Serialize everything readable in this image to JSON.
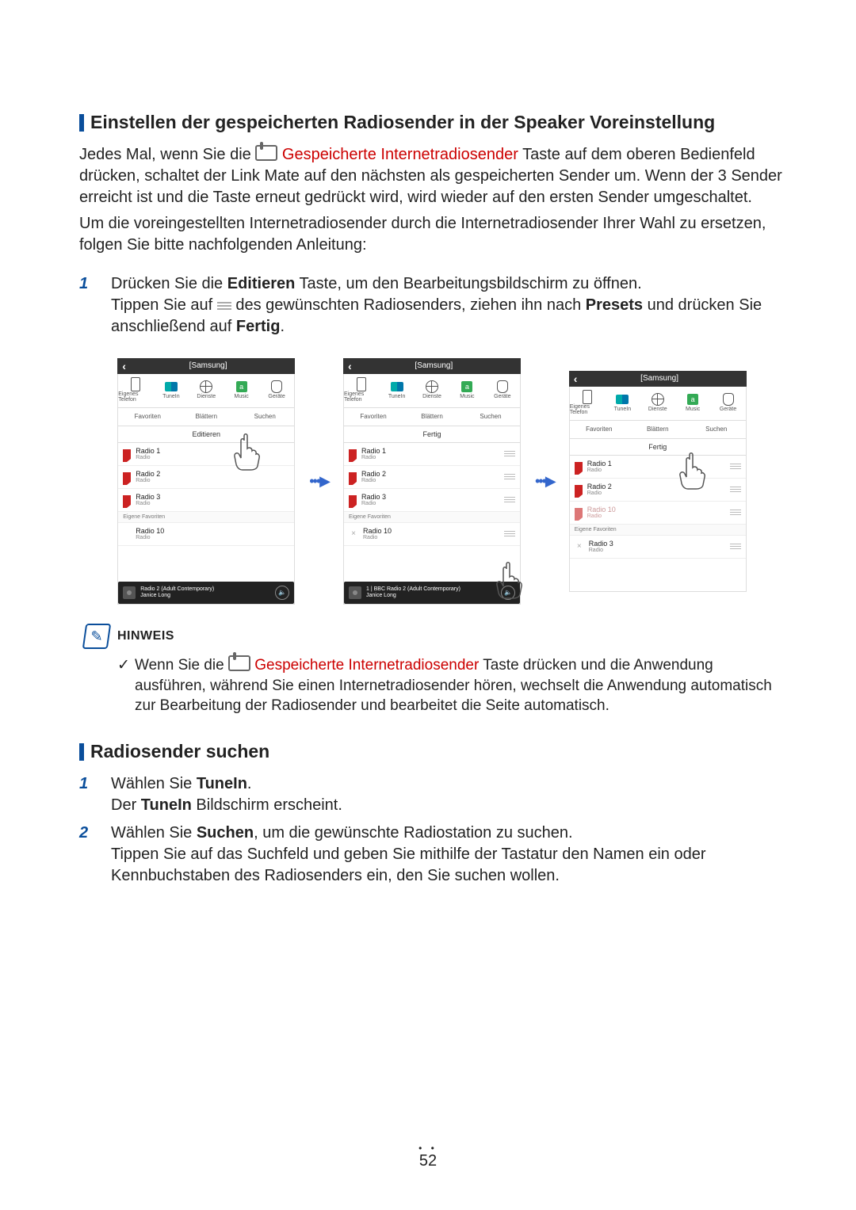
{
  "section1": {
    "heading": "Einstellen der gespeicherten Radiosender in der Speaker Voreinstellung",
    "p1a": "Jedes Mal, wenn Sie die ",
    "p1b_red": "Gespeicherte Internetradiosender",
    "p1c": " Taste auf dem oberen Bedienfeld drücken, schaltet der Link Mate auf den nächsten als gespeicherten Sender um. Wenn der 3 Sender erreicht ist und die Taste erneut gedrückt wird, wird wieder auf den ersten Sender umgeschaltet.",
    "p2": "Um die voreingestellten Internetradiosender durch die Internetradiosender Ihrer Wahl zu ersetzen, folgen Sie bitte nachfolgenden Anleitung:",
    "step1_num": "1",
    "step1a": "Drücken Sie die ",
    "step1_bold1": "Editieren",
    "step1b": " Taste, um den Bearbeitungsbildschirm zu öffnen.",
    "step1c": "Tippen Sie auf ",
    "step1d": " des gewünschten Radiosenders, ziehen ihn nach ",
    "step1_bold2": "Presets",
    "step1e": " und drücken Sie anschließend auf ",
    "step1_bold3": "Fertig",
    "step1f": "."
  },
  "phone": {
    "title": "[Samsung]",
    "nav": {
      "own": "Eigenes Telefon",
      "tunein": "TuneIn",
      "dienste": "Dienste",
      "music": "Music",
      "gerate": "Geräte"
    },
    "tabs": {
      "fav": "Favoriten",
      "browse": "Blättern",
      "search": "Suchen"
    },
    "edit": "Editieren",
    "done": "Fertig",
    "eigene": "Eigene Favoriten",
    "radio_sub": "Radio",
    "r1": "Radio 1",
    "r2": "Radio 2",
    "r3": "Radio 3",
    "r10": "Radio 10",
    "np1_title": "Radio 2 (Adult Contemporary)",
    "np2_title": "1 | BBC Radio 2 (Adult Contemporary)",
    "np_sub": "Janice Long",
    "amazon_glyph": "a"
  },
  "hinweis": {
    "label": "HINWEIS",
    "note_a": "Wenn Sie die ",
    "note_red": "Gespeicherte Internetradiosender",
    "note_b": " Taste drücken und die Anwendung ausführen, während Sie einen Internetradiosender hören, wechselt die Anwendung automatisch zur Bearbeitung der Radiosender und bearbeitet die Seite automatisch."
  },
  "section2": {
    "heading": "Radiosender suchen",
    "s1_num": "1",
    "s1a": "Wählen Sie ",
    "s1_bold": "TuneIn",
    "s1b": ".",
    "s1c": "Der ",
    "s1_bold2": "TuneIn",
    "s1d": " Bildschirm erscheint.",
    "s2_num": "2",
    "s2a": "Wählen Sie ",
    "s2_bold": "Suchen",
    "s2b": ", um die gewünschte Radiostation zu suchen.",
    "s2c": "Tippen Sie auf das Suchfeld und geben Sie mithilfe der Tastatur den Namen ein oder Kennbuchstaben des Radiosenders ein, den Sie suchen wollen."
  },
  "pagenum": "52"
}
